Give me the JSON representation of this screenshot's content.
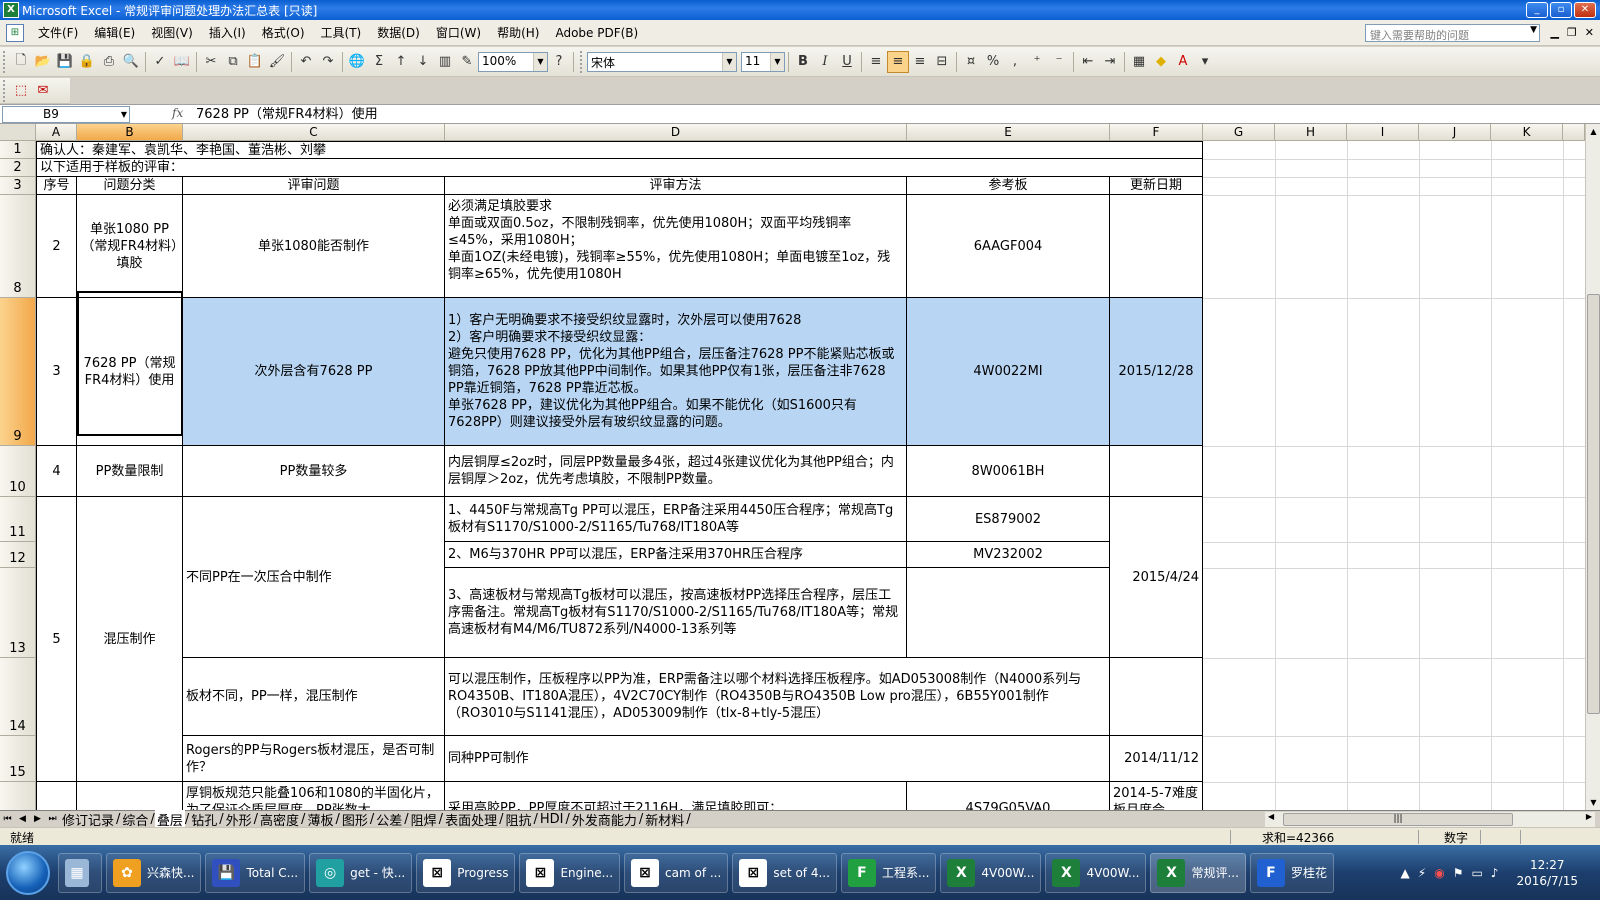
{
  "window": {
    "title": "Microsoft Excel - 常规评审问题处理办法汇总表  [只读]",
    "buttons": [
      "_",
      "▫",
      "✕"
    ]
  },
  "menu": {
    "items": [
      "文件(F)",
      "编辑(E)",
      "视图(V)",
      "插入(I)",
      "格式(O)",
      "工具(T)",
      "数据(D)",
      "窗口(W)",
      "帮助(H)",
      "Adobe PDF(B)"
    ],
    "help_placeholder": "键入需要帮助的问题"
  },
  "toolbar": {
    "zoom": "100%",
    "font_name": "宋体",
    "font_size": "11",
    "bold": "B",
    "italic": "I",
    "underline": "U",
    "percent": "%",
    "comma": ","
  },
  "formula_bar": {
    "name_box": "B9",
    "fx": "fx",
    "formula": "7628 PP（常规FR4材料）使用"
  },
  "columns": [
    "A",
    "B",
    "C",
    "D",
    "E",
    "F",
    "G",
    "H",
    "I",
    "J",
    "K"
  ],
  "rows": {
    "r1": "1",
    "r2": "2",
    "r3": "3",
    "r8": "8",
    "r9": "9",
    "r10": "10",
    "r11": "11",
    "r12": "12",
    "r13": "13",
    "r14": "14",
    "r15": "15"
  },
  "sheet": {
    "confirm": "确认人：秦建军、袁凯华、李艳国、董浩彬、刘攀",
    "scope": "以下适用于样板的评审：",
    "headers": {
      "seq": "序号",
      "category": "问题分类",
      "issue": "评审问题",
      "method": "评审方法",
      "reference": "参考板",
      "updated": "更新日期"
    },
    "row8": {
      "seq": "2",
      "category": "单张1080 PP（常规FR4材料）填胶",
      "issue": "单张1080能否制作",
      "method": "必须满足填胶要求\n单面或双面0.5oz，不限制残铜率，优先使用1080H；双面平均残铜率≤45%，采用1080H；\n单面1OZ(未经电镀)，残铜率≥55%，优先使用1080H；单面电镀至1oz，残铜率≥65%，优先使用1080H",
      "reference": "6AAGF004",
      "updated": ""
    },
    "row9": {
      "seq": "3",
      "category": "7628 PP（常规FR4材料）使用",
      "issue": "次外层含有7628 PP",
      "method": "1）客户无明确要求不接受织纹显露时，次外层可以使用7628\n2）客户明确要求不接受织纹显露：\n避免只使用7628 PP，优化为其他PP组合，层压备注7628 PP不能紧贴芯板或铜箔，7628 PP放其他PP中间制作。如果其他PP仅有1张，层压备注非7628 PP靠近铜箔，7628 PP靠近芯板。\n单张7628 PP，建议优化为其他PP组合。如果不能优化（如S1600只有7628PP）则建议接受外层有玻织纹显露的问题。",
      "reference": "4W0022MI",
      "updated": "2015/12/28"
    },
    "row10": {
      "seq": "4",
      "category": "PP数量限制",
      "issue": "PP数量较多",
      "method": "内层铜厚≤2oz时，同层PP数量最多4张，超过4张建议优化为其他PP组合；内层铜厚＞2oz，优先考虑填胶，不限制PP数量。",
      "reference": "8W0061BH",
      "updated": ""
    },
    "group5": {
      "seq": "5",
      "category": "混压制作",
      "issue_a": "不同PP在一次压合中制作",
      "method_11": "1、4450F与常规高Tg PP可以混压，ERP备注采用4450压合程序；常规高Tg板材有S1170/S1000-2/S1165/Tu768/IT180A等",
      "reference_11": "ES879002",
      "method_12": "2、M6与370HR PP可以混压，ERP备注采用370HR压合程序",
      "reference_12": "MV232002",
      "method_13": "3、高速板材与常规高Tg板材可以混压，按高速板材PP选择压合程序，层压工序需备注。常规高Tg板材有S1170/S1000-2/S1165/Tu768/IT180A等；常规高速板材有M4/M6/TU872系列/N4000-13系列等",
      "updated_a": "2015/4/24",
      "issue_14": "板材不同，PP一样，混压制作",
      "method_14": "可以混压制作，压板程序以PP为准，ERP需备注以哪个材料选择压板程序。如AD053008制作（N4000系列与RO4350B、IT180A混压），4V2C70CY制作（RO4350B与RO4350B Low pro混压），6B55Y001制作（RO3010与S1141混压），AD053009制作（tlx-8+tly-5混压）",
      "issue_15": "Rogers的PP与Rogers板材混压，是否可制作？",
      "method_15": "同种PP可制作",
      "updated_15": "2014/11/12"
    },
    "row16": {
      "issue": "厚铜板规范只能叠106和1080的半固化片，为了保证介质层厚度，PP张数太",
      "method": "采用高胶PP，PP厚度不可超过于2116H，满足填胶即可；",
      "reference": "4S79G05VA0",
      "updated": "2014-5-7难度板月度会"
    }
  },
  "tabs": [
    "修订记录",
    "综合",
    "叠层",
    "钻孔",
    "外形",
    "高密度",
    "薄板",
    "图形",
    "公差",
    "阻焊",
    "表面处理",
    "阻抗",
    "HDI",
    "外发商能力",
    "新材料"
  ],
  "status": {
    "ready": "就绪",
    "sum": "求和=42366",
    "mode": "数字"
  },
  "taskbar": {
    "tasks": [
      "兴森快...",
      "Total C...",
      "get - 快...",
      "Progress",
      "Engine...",
      "cam of ...",
      "set of 4...",
      "工程系...",
      "4V00W...",
      "4V00W...",
      "常规评...",
      "罗桂花"
    ],
    "time": "12:27",
    "date": "2016/7/15"
  }
}
